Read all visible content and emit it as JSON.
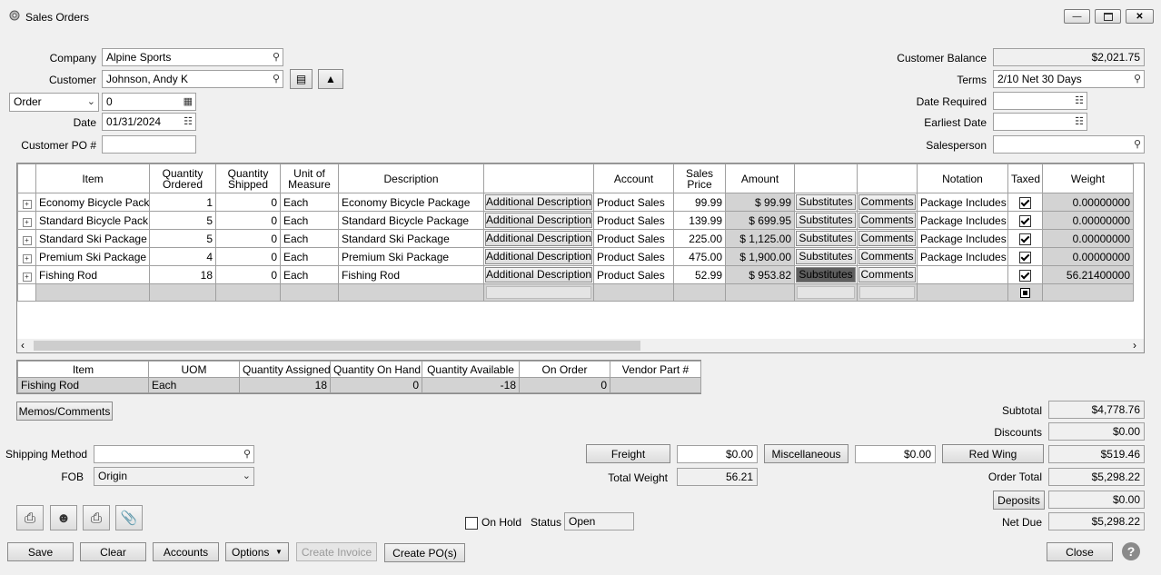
{
  "window": {
    "title": "Sales Orders"
  },
  "header": {
    "company_label": "Company",
    "company_value": "Alpine Sports",
    "customer_label": "Customer",
    "customer_value": "Johnson, Andy K",
    "doc_type_value": "Order",
    "doc_number_value": "0",
    "date_label": "Date",
    "date_value": "01/31/2024",
    "customer_po_label": "Customer PO #",
    "customer_po_value": "",
    "customer_balance_label": "Customer Balance",
    "customer_balance_value": "$2,021.75",
    "terms_label": "Terms",
    "terms_value": "2/10 Net 30 Days",
    "date_required_label": "Date Required",
    "date_required_value": "",
    "earliest_date_label": "Earliest Date",
    "earliest_date_value": "",
    "salesperson_label": "Salesperson",
    "salesperson_value": ""
  },
  "lines": {
    "columns": [
      "Item",
      "Quantity Ordered",
      "Quantity Shipped",
      "Unit of Measure",
      "Description",
      "",
      "Account",
      "Sales Price",
      "Amount",
      "",
      "",
      "Notation",
      "Taxed",
      "Weight"
    ],
    "additional_label": "Additional Description",
    "substitutes_label": "Substitutes",
    "comments_label": "Comments",
    "rows": [
      {
        "item": "Economy Bicycle Pack",
        "qty_ordered": "1",
        "qty_shipped": "0",
        "uom": "Each",
        "description": "Economy Bicycle Package",
        "account": "Product Sales",
        "price": "99.99",
        "amount": "$ 99.99",
        "notation": "Package Includes",
        "taxed": true,
        "weight": "0.00000000"
      },
      {
        "item": "Standard Bicycle Pack",
        "qty_ordered": "5",
        "qty_shipped": "0",
        "uom": "Each",
        "description": "Standard Bicycle Package",
        "account": "Product Sales",
        "price": "139.99",
        "amount": "$ 699.95",
        "notation": "Package Includes",
        "taxed": true,
        "weight": "0.00000000"
      },
      {
        "item": "Standard Ski Package",
        "qty_ordered": "5",
        "qty_shipped": "0",
        "uom": "Each",
        "description": "Standard Ski Package",
        "account": "Product Sales",
        "price": "225.00",
        "amount": "$ 1,125.00",
        "notation": "Package Includes",
        "taxed": true,
        "weight": "0.00000000"
      },
      {
        "item": "Premium Ski Package",
        "qty_ordered": "4",
        "qty_shipped": "0",
        "uom": "Each",
        "description": "Premium Ski Package",
        "account": "Product Sales",
        "price": "475.00",
        "amount": "$ 1,900.00",
        "notation": "Package Includes",
        "taxed": true,
        "weight": "0.00000000"
      },
      {
        "item": "Fishing Rod",
        "qty_ordered": "18",
        "qty_shipped": "0",
        "uom": "Each",
        "description": "Fishing Rod",
        "account": "Product Sales",
        "price": "52.99",
        "amount": "$ 953.82",
        "notation": "",
        "taxed": true,
        "weight": "56.21400000"
      }
    ]
  },
  "detail": {
    "columns": [
      "Item",
      "UOM",
      "Quantity Assigned",
      "Quantity On Hand",
      "Quantity Available",
      "On Order",
      "Vendor Part #"
    ],
    "row": {
      "item": "Fishing Rod",
      "uom": "Each",
      "assigned": "18",
      "on_hand": "0",
      "available": "-18",
      "on_order": "0",
      "vendor_part": ""
    }
  },
  "footer": {
    "memos_label": "Memos/Comments",
    "shipping_method_label": "Shipping Method",
    "shipping_method_value": "",
    "fob_label": "FOB",
    "fob_value": "Origin",
    "freight_label": "Freight",
    "freight_value": "$0.00",
    "misc_label": "Miscellaneous",
    "misc_value": "$0.00",
    "redwing_label": "Red Wing",
    "total_weight_label": "Total Weight",
    "total_weight_value": "56.21",
    "on_hold_label": "On Hold",
    "status_label": "Status",
    "status_value": "Open",
    "subtotal_label": "Subtotal",
    "subtotal_value": "$4,778.76",
    "discounts_label": "Discounts",
    "discounts_value": "$0.00",
    "redwing_value": "$519.46",
    "order_total_label": "Order Total",
    "order_total_value": "$5,298.22",
    "deposits_label": "Deposits",
    "deposits_value": "$0.00",
    "net_due_label": "Net Due",
    "net_due_value": "$5,298.22"
  },
  "buttons": {
    "save": "Save",
    "clear": "Clear",
    "accounts": "Accounts",
    "options": "Options",
    "create_invoice": "Create Invoice",
    "create_po": "Create PO(s)",
    "close": "Close"
  }
}
